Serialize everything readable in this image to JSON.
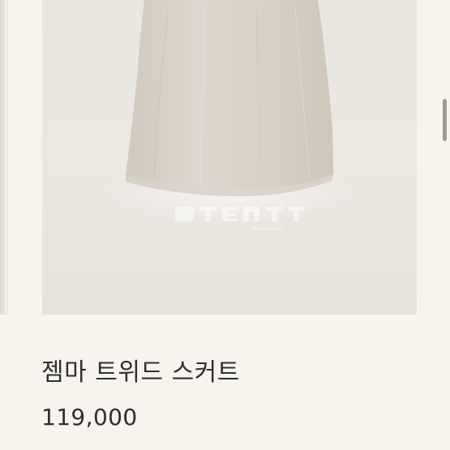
{
  "product": {
    "name": "젬마 트위드 스커트",
    "price": "119,000",
    "image_icon": "tweed-skirt-product-photo"
  },
  "colors": {
    "page_background": "#f7f4ee",
    "card_background": "#ebe7e2",
    "skirt_fabric": "#d8d0c4",
    "text": "#2f2f2f",
    "scrollbar": "#9d9a94"
  }
}
